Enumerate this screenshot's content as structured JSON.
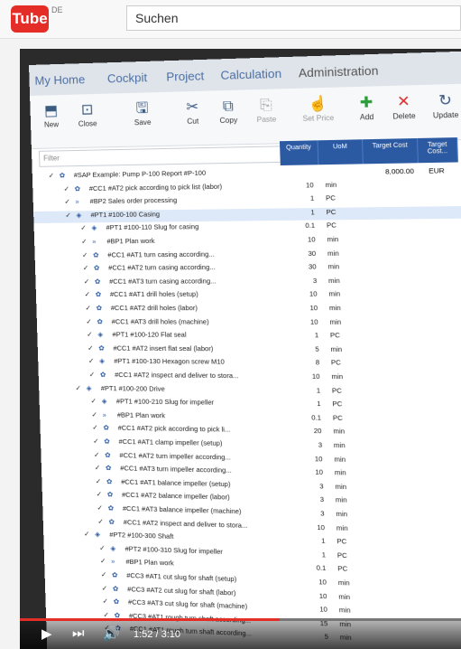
{
  "youtube": {
    "logo_text": "Tube",
    "region": "DE",
    "search_placeholder": "Suchen"
  },
  "player": {
    "current_time": "1:52",
    "duration": "3:10",
    "time_display": "1:52 / 3:10",
    "progress_fraction": 0.589
  },
  "app": {
    "tabs": [
      "My Home",
      "Cockpit",
      "Project",
      "Calculation",
      "Administration"
    ],
    "active_tab": "Calculation",
    "toolbar": [
      "New",
      "Close",
      "Save",
      "Cut",
      "Copy",
      "Paste",
      "Set Price",
      "Add",
      "Delete",
      "Update"
    ],
    "filter_placeholder": "Filter",
    "columns": [
      "Quantity",
      "UoM",
      "Target Cost",
      "Target Cost..."
    ],
    "top_target_cost": "8,000.00",
    "top_currency": "EUR",
    "rows": [
      {
        "level": 0,
        "label": "#SAP Example: Pump P-100   Report   #P-100",
        "qty": "",
        "uom": ""
      },
      {
        "level": 1,
        "label": "#CC1  #AT2   pick according to pick list (labor)",
        "qty": "10",
        "uom": "min"
      },
      {
        "level": 1,
        "label": "#BP2   Sales order processing",
        "qty": "1",
        "uom": "PC"
      },
      {
        "level": 1,
        "label": "#PT1   #100-100   Casing",
        "qty": "1",
        "uom": "PC"
      },
      {
        "level": 2,
        "label": "#PT1   #100-110   Slug for casing",
        "qty": "0.1",
        "uom": "PC"
      },
      {
        "level": 2,
        "label": "#BP1   Plan work",
        "qty": "10",
        "uom": "min"
      },
      {
        "level": 2,
        "label": "#CC1  #AT1   turn casing according...",
        "qty": "30",
        "uom": "min"
      },
      {
        "level": 2,
        "label": "#CC1  #AT2   turn casing according...",
        "qty": "30",
        "uom": "min"
      },
      {
        "level": 2,
        "label": "#CC1  #AT3   turn casing according...",
        "qty": "3",
        "uom": "min"
      },
      {
        "level": 2,
        "label": "#CC1  #AT1   drill holes (setup)",
        "qty": "10",
        "uom": "min"
      },
      {
        "level": 2,
        "label": "#CC1  #AT2   drill holes (labor)",
        "qty": "10",
        "uom": "min"
      },
      {
        "level": 2,
        "label": "#CC1  #AT3   drill holes (machine)",
        "qty": "10",
        "uom": "min"
      },
      {
        "level": 2,
        "label": "#PT1   #100-120   Flat seal",
        "qty": "1",
        "uom": "PC"
      },
      {
        "level": 2,
        "label": "#CC1  #AT2   insert flat seal (labor)",
        "qty": "5",
        "uom": "min"
      },
      {
        "level": 2,
        "label": "#PT1   #100-130   Hexagon screw M10",
        "qty": "8",
        "uom": "PC"
      },
      {
        "level": 2,
        "label": "#CC1  #AT2   inspect and deliver to stora...",
        "qty": "10",
        "uom": "min"
      },
      {
        "level": 1,
        "label": "#PT1   #100-200   Drive",
        "qty": "1",
        "uom": "PC"
      },
      {
        "level": 2,
        "label": "#PT1   #100-210   Slug for impeller",
        "qty": "1",
        "uom": "PC"
      },
      {
        "level": 2,
        "label": "#BP1   Plan work",
        "qty": "0.1",
        "uom": "PC"
      },
      {
        "level": 2,
        "label": "#CC1  #AT2   pick according to pick li...",
        "qty": "20",
        "uom": "min"
      },
      {
        "level": 2,
        "label": "#CC1  #AT1   clamp impeller (setup)",
        "qty": "3",
        "uom": "min"
      },
      {
        "level": 2,
        "label": "#CC1  #AT2   turn impeller according...",
        "qty": "10",
        "uom": "min"
      },
      {
        "level": 2,
        "label": "#CC1  #AT3   turn impeller according...",
        "qty": "10",
        "uom": "min"
      },
      {
        "level": 2,
        "label": "#CC1  #AT1   balance impeller (setup)",
        "qty": "3",
        "uom": "min"
      },
      {
        "level": 2,
        "label": "#CC1  #AT2   balance impeller (labor)",
        "qty": "3",
        "uom": "min"
      },
      {
        "level": 2,
        "label": "#CC1  #AT3   balance impeller (machine)",
        "qty": "3",
        "uom": "min"
      },
      {
        "level": 2,
        "label": "#CC1  #AT2   inspect and deliver to stora...",
        "qty": "10",
        "uom": "min"
      },
      {
        "level": 1,
        "label": "#PT2   #100-300   Shaft",
        "qty": "1",
        "uom": "PC"
      },
      {
        "level": 2,
        "label": "#PT2   #100-310   Slug for impeller",
        "qty": "1",
        "uom": "PC"
      },
      {
        "level": 2,
        "label": "#BP1   Plan work",
        "qty": "0.1",
        "uom": "PC"
      },
      {
        "level": 2,
        "label": "#CC3  #AT1   cut slug for shaft (setup)",
        "qty": "10",
        "uom": "min"
      },
      {
        "level": 2,
        "label": "#CC3  #AT2   cut slug for shaft (labor)",
        "qty": "10",
        "uom": "min"
      },
      {
        "level": 2,
        "label": "#CC3  #AT3   cut slug for shaft (machine)",
        "qty": "10",
        "uom": "min"
      },
      {
        "level": 2,
        "label": "#CC3  #AT1   rough turn shaft according...",
        "qty": "15",
        "uom": "min"
      },
      {
        "level": 2,
        "label": "#CC1  #AT1   rough turn shaft according...",
        "qty": "5",
        "uom": "min"
      }
    ]
  }
}
